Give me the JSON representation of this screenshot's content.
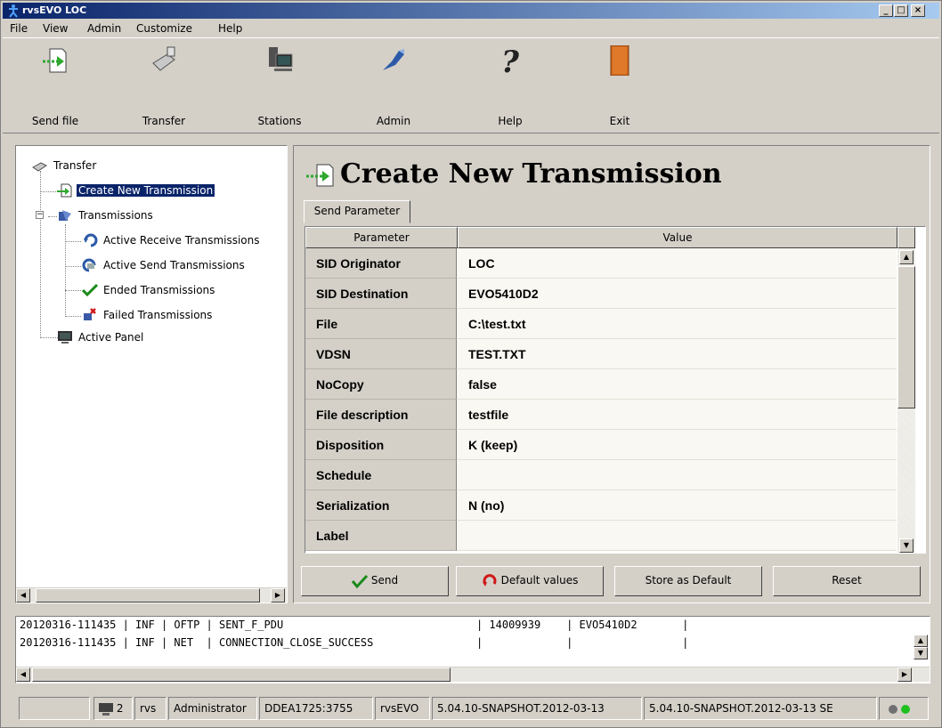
{
  "window": {
    "title": "rvsEVO LOC"
  },
  "menu": {
    "file": "File",
    "view": "View",
    "admin": "Admin",
    "customize": "Customize",
    "help": "Help"
  },
  "toolbar": {
    "send_file": "Send file",
    "transfer": "Transfer",
    "stations": "Stations",
    "admin": "Admin",
    "help": "Help",
    "exit": "Exit"
  },
  "tree": {
    "transfer": "Transfer",
    "create_new": "Create New Transmission",
    "transmissions": "Transmissions",
    "active_receive": "Active Receive Transmissions",
    "active_send": "Active Send Transmissions",
    "ended": "Ended Transmissions",
    "failed": "Failed Transmissions",
    "active_panel": "Active Panel"
  },
  "main": {
    "title": "Create New Transmission",
    "tab": "Send Parameter",
    "headers": {
      "parameter": "Parameter",
      "value": "Value"
    },
    "rows": [
      {
        "param": "SID Originator",
        "value": "LOC"
      },
      {
        "param": "SID Destination",
        "value": "EVO5410D2"
      },
      {
        "param": "File",
        "value": "C:\\test.txt"
      },
      {
        "param": "VDSN",
        "value": "TEST.TXT"
      },
      {
        "param": "NoCopy",
        "value": "false"
      },
      {
        "param": "File description",
        "value": "testfile"
      },
      {
        "param": "Disposition",
        "value": "K (keep)"
      },
      {
        "param": "Schedule",
        "value": ""
      },
      {
        "param": "Serialization",
        "value": "N (no)"
      },
      {
        "param": "Label",
        "value": ""
      }
    ],
    "buttons": {
      "send": "Send",
      "default_values": "Default values",
      "store_default": "Store as Default",
      "reset": "Reset"
    }
  },
  "log": [
    "20120316-111435 | INF | OFTP | SENT_F_PDU                              | 14009939    | EVO5410D2       |",
    "20120316-111435 | INF | NET  | CONNECTION_CLOSE_SUCCESS                |             |                 |"
  ],
  "status": {
    "count": "2",
    "user": "rvs",
    "role": "Administrator",
    "host": "DDEA1725:3755",
    "app": "rvsEVO",
    "version1": "5.04.10-SNAPSHOT.2012-03-13",
    "version2": "5.04.10-SNAPSHOT.2012-03-13 SE"
  }
}
